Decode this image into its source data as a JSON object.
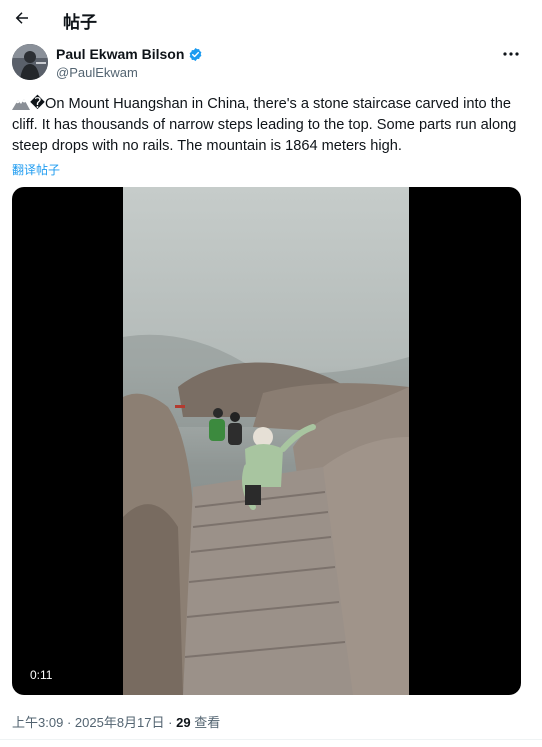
{
  "header": {
    "title": "帖子",
    "back_icon": "arrow-left-icon"
  },
  "author": {
    "name": "Paul Ekwam Bilson",
    "handle": "@PaulEkwam",
    "verified": true,
    "verified_color": "#1d9bf0"
  },
  "tweet": {
    "emoji": "mountain-emoji",
    "text": "�On Mount Huangshan in China, there's a stone staircase carved into the cliff. It has thousands of narrow steps leading to the top. Some parts run along steep drops with no rails. The mountain is 1864 meters high.",
    "translate_label": "翻译帖子"
  },
  "video": {
    "duration": "0:11"
  },
  "meta": {
    "time": "上午3:09",
    "separator": "·",
    "date": "2025年8月17日",
    "views_count": "29",
    "views_label": "查看"
  },
  "colors": {
    "accent": "#1d9bf0",
    "text": "#0f1419",
    "muted": "#536471"
  }
}
